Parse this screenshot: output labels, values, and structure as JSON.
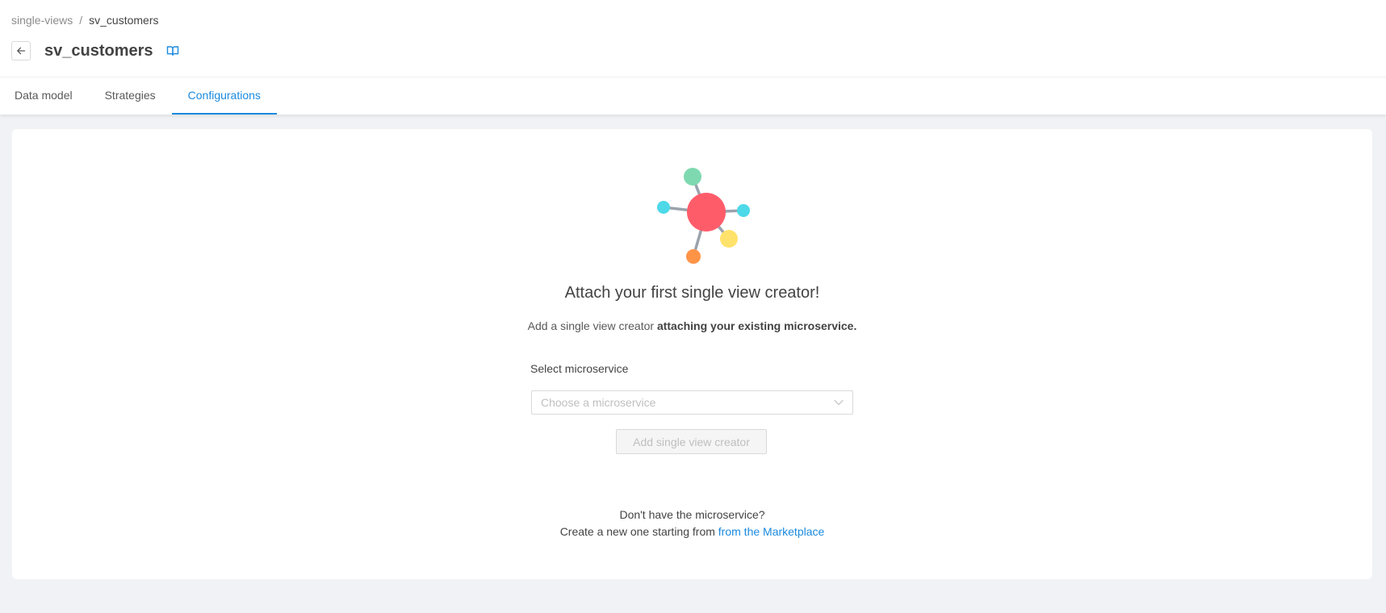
{
  "breadcrumb": {
    "parent": "single-views",
    "separator": "/",
    "current": "sv_customers"
  },
  "page": {
    "title": "sv_customers",
    "back_icon": "arrow-left-icon",
    "docs_icon": "book-icon"
  },
  "tabs": [
    {
      "label": "Data model",
      "active": false
    },
    {
      "label": "Strategies",
      "active": false
    },
    {
      "label": "Configurations",
      "active": true
    }
  ],
  "empty_state": {
    "title": "Attach your first single view creator!",
    "description_prefix": "Add a single view creator ",
    "description_bold": "attaching your existing microservice.",
    "field_label": "Select microservice",
    "select_placeholder": "Choose a microservice",
    "add_button_label": "Add single view creator",
    "footer_question": "Don't have the microservice?",
    "footer_prefix": "Create a new one starting from ",
    "footer_link": "from the Marketplace"
  },
  "colors": {
    "accent": "#1a8ae0",
    "node_center": "#ff5c6a",
    "node_green": "#7ed9b0",
    "node_cyan": "#4dd9e8",
    "node_yellow": "#ffe26b",
    "node_orange": "#ff9447",
    "edge": "#9aa3ad"
  }
}
